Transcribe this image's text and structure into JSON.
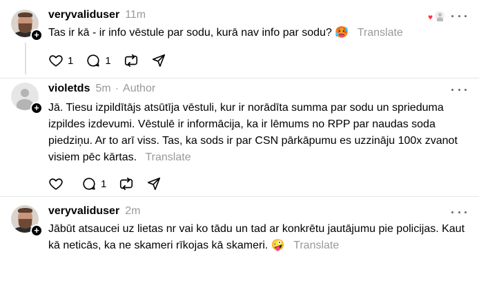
{
  "comments": [
    {
      "username": "veryvaliduser",
      "time": "11m",
      "author_tag": "",
      "text": "Tas ir kā - ir info vēstule par sodu, kurā nav info par sodu?",
      "emoji": "🥵",
      "translate": "Translate",
      "likes": "1",
      "replies": "1",
      "avatar": "photo",
      "has_reactions": true
    },
    {
      "username": "violetds",
      "time": "5m",
      "author_tag": "Author",
      "text": "Jā. Tiesu izpildītājs atsūtīja vēstuli, kur ir norādīta summa par sodu un sprieduma izpildes izdevumi. Vēstulē ir informācija, ka ir lēmums no RPP par naudas soda piedziņu. Ar to arī viss. Tas, ka sods ir par CSN pārkāpumu es uzzināju 100x zvanot visiem pēc kārtas.",
      "emoji": "",
      "translate": "Translate",
      "likes": "",
      "replies": "1",
      "avatar": "generic"
    },
    {
      "username": "veryvaliduser",
      "time": "2m",
      "author_tag": "",
      "text": "Jābūt atsaucei uz lietas nr vai ko tādu un tad ar konkrētu jautājumu pie policijas. Kaut kā neticās, ka ne skameri rīkojas kā skameri.",
      "emoji": "🤪",
      "translate": "Translate",
      "avatar": "photo"
    }
  ],
  "separator": "·",
  "icons": {
    "like": "heart-icon",
    "reply": "comment-icon",
    "repost": "repost-icon",
    "share": "send-icon",
    "more": "more-icon",
    "follow": "plus-icon"
  },
  "colors": {
    "secondary_text": "#999999",
    "reaction_heart": "#ff3040"
  }
}
